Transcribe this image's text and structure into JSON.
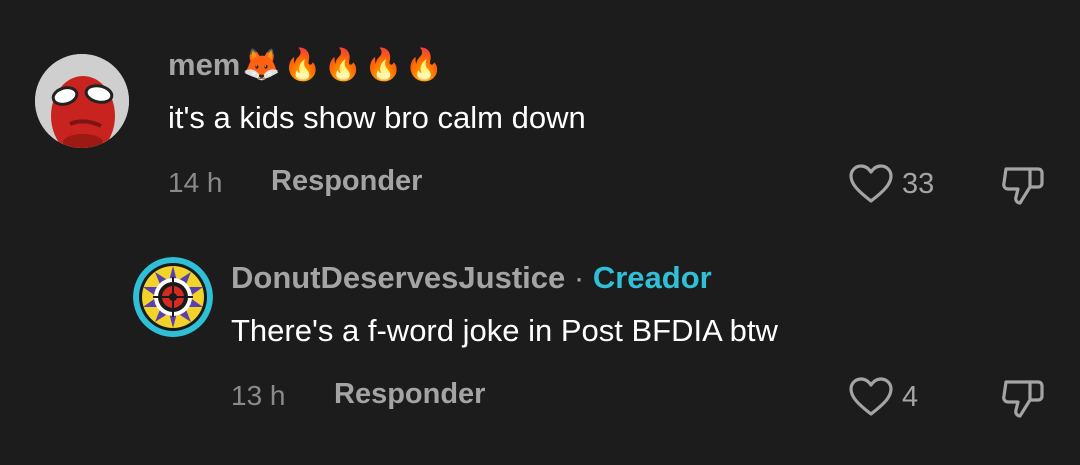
{
  "comments": [
    {
      "username": "mem",
      "emojis": "🦊🔥🔥🔥🔥",
      "text": "it's a kids show bro calm down",
      "time": "14 h",
      "reply_label": "Responder",
      "likes": "33"
    },
    {
      "username": "DonutDeservesJustice",
      "separator": "·",
      "badge": "Creador",
      "text": "There's a f-word joke in Post BFDIA btw",
      "time": "13 h",
      "reply_label": "Responder",
      "likes": "4"
    }
  ],
  "colors": {
    "background": "#1c1c1c",
    "creator_badge": "#2fc0d8",
    "text": "#ffffff",
    "muted": "#a4a4a4"
  }
}
